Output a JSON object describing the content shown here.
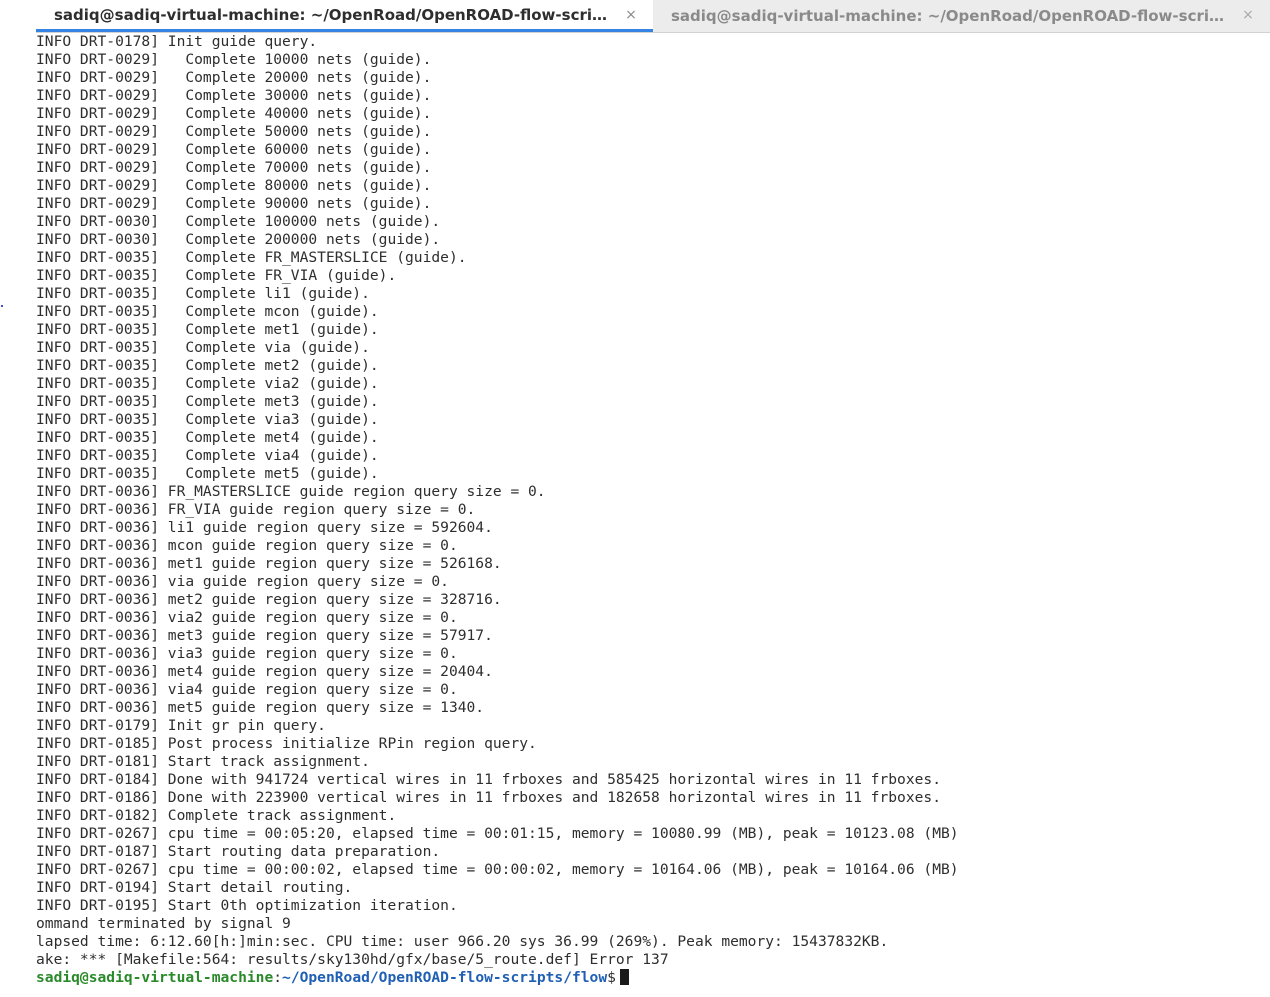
{
  "window": {
    "tabs": [
      {
        "title": "sadiq@sadiq-virtual-machine: ~/OpenRoad/OpenROAD-flow-scripts/flow",
        "active": true
      },
      {
        "title": "sadiq@sadiq-virtual-machine: ~/OpenRoad/OpenROAD-flow-scripts/flow",
        "active": false
      }
    ],
    "close_glyph": "×"
  },
  "terminal": {
    "lines": [
      "INFO DRT-0178] Init guide query.",
      "INFO DRT-0029]   Complete 10000 nets (guide).",
      "INFO DRT-0029]   Complete 20000 nets (guide).",
      "INFO DRT-0029]   Complete 30000 nets (guide).",
      "INFO DRT-0029]   Complete 40000 nets (guide).",
      "INFO DRT-0029]   Complete 50000 nets (guide).",
      "INFO DRT-0029]   Complete 60000 nets (guide).",
      "INFO DRT-0029]   Complete 70000 nets (guide).",
      "INFO DRT-0029]   Complete 80000 nets (guide).",
      "INFO DRT-0029]   Complete 90000 nets (guide).",
      "INFO DRT-0030]   Complete 100000 nets (guide).",
      "INFO DRT-0030]   Complete 200000 nets (guide).",
      "INFO DRT-0035]   Complete FR_MASTERSLICE (guide).",
      "INFO DRT-0035]   Complete FR_VIA (guide).",
      "INFO DRT-0035]   Complete li1 (guide).",
      "INFO DRT-0035]   Complete mcon (guide).",
      "INFO DRT-0035]   Complete met1 (guide).",
      "INFO DRT-0035]   Complete via (guide).",
      "INFO DRT-0035]   Complete met2 (guide).",
      "INFO DRT-0035]   Complete via2 (guide).",
      "INFO DRT-0035]   Complete met3 (guide).",
      "INFO DRT-0035]   Complete via3 (guide).",
      "INFO DRT-0035]   Complete met4 (guide).",
      "INFO DRT-0035]   Complete via4 (guide).",
      "INFO DRT-0035]   Complete met5 (guide).",
      "INFO DRT-0036] FR_MASTERSLICE guide region query size = 0.",
      "INFO DRT-0036] FR_VIA guide region query size = 0.",
      "INFO DRT-0036] li1 guide region query size = 592604.",
      "INFO DRT-0036] mcon guide region query size = 0.",
      "INFO DRT-0036] met1 guide region query size = 526168.",
      "INFO DRT-0036] via guide region query size = 0.",
      "INFO DRT-0036] met2 guide region query size = 328716.",
      "INFO DRT-0036] via2 guide region query size = 0.",
      "INFO DRT-0036] met3 guide region query size = 57917.",
      "INFO DRT-0036] via3 guide region query size = 0.",
      "INFO DRT-0036] met4 guide region query size = 20404.",
      "INFO DRT-0036] via4 guide region query size = 0.",
      "INFO DRT-0036] met5 guide region query size = 1340.",
      "INFO DRT-0179] Init gr pin query.",
      "INFO DRT-0185] Post process initialize RPin region query.",
      "INFO DRT-0181] Start track assignment.",
      "INFO DRT-0184] Done with 941724 vertical wires in 11 frboxes and 585425 horizontal wires in 11 frboxes.",
      "INFO DRT-0186] Done with 223900 vertical wires in 11 frboxes and 182658 horizontal wires in 11 frboxes.",
      "INFO DRT-0182] Complete track assignment.",
      "INFO DRT-0267] cpu time = 00:05:20, elapsed time = 00:01:15, memory = 10080.99 (MB), peak = 10123.08 (MB)",
      "INFO DRT-0187] Start routing data preparation.",
      "INFO DRT-0267] cpu time = 00:00:02, elapsed time = 00:00:02, memory = 10164.06 (MB), peak = 10164.06 (MB)",
      "INFO DRT-0194] Start detail routing.",
      "INFO DRT-0195] Start 0th optimization iteration.",
      "ommand terminated by signal 9",
      "lapsed time: 6:12.60[h:]min:sec. CPU time: user 966.20 sys 36.99 (269%). Peak memory: 15437832KB.",
      "ake: *** [Makefile:564: results/sky130hd/gfx/base/5_route.def] Error 137"
    ],
    "prompt": {
      "user_host": "sadiq@sadiq-virtual-machine",
      "separator": ":",
      "path": "~/OpenRoad/OpenROAD-flow-scripts/flow",
      "symbol": "$"
    }
  }
}
